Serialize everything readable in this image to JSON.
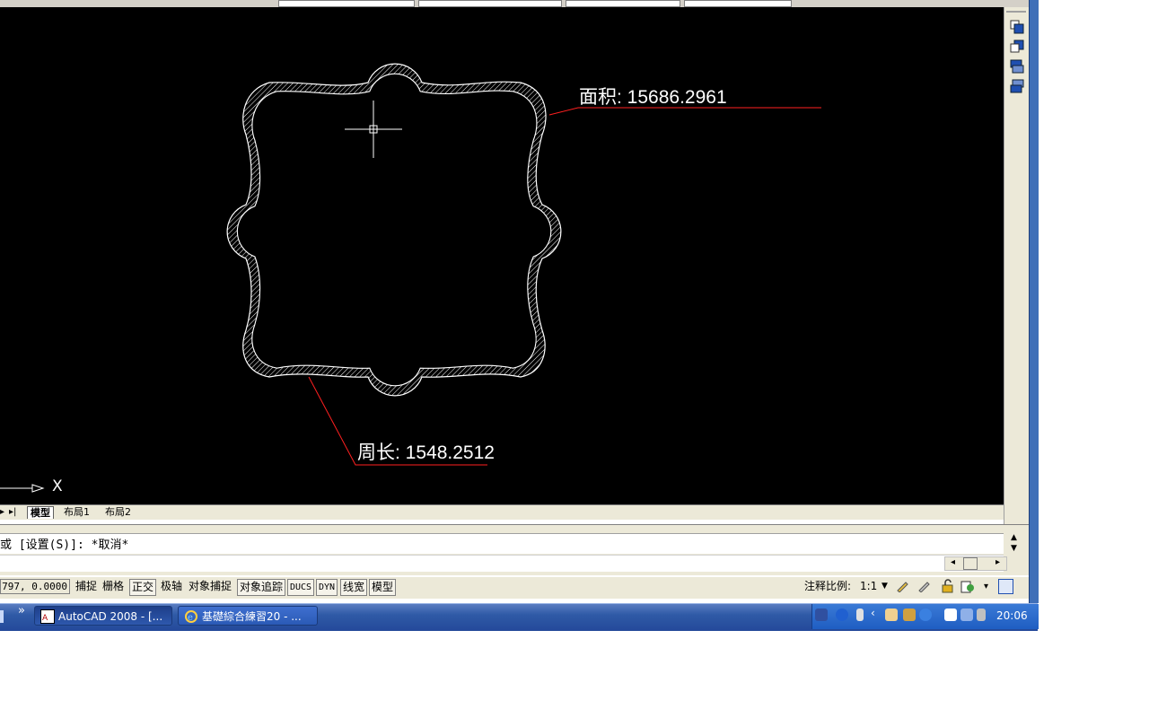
{
  "drawing": {
    "area_label": "面积",
    "area_value": "15686.2961",
    "perimeter_label": "周长",
    "perimeter_value": "1548.2512",
    "ucs_axis_x": "X"
  },
  "layout_tabs": {
    "model": "模型",
    "layout1": "布局1",
    "layout2": "布局2"
  },
  "command_line": {
    "history_text": "或 [设置(S)]: *取消*",
    "input_text": ""
  },
  "status_bar": {
    "coordinates": "797, 0.0000",
    "toggles": [
      "捕捉",
      "栅格",
      "正交",
      "极轴",
      "对象捕捉",
      "对象追踪",
      "DUCS",
      "DYN",
      "线宽",
      "模型"
    ],
    "annotation_scale_label": "注释比例:",
    "annotation_scale_value": "1:1"
  },
  "taskbar": {
    "tasks": [
      "AutoCAD 2008 - [...",
      "基礎綜合練習20 - ..."
    ],
    "clock": "20:06",
    "chevron": "»"
  },
  "colors": {
    "canvas": "#000000",
    "leader": "#ff2020",
    "text": "#ffffff",
    "window_bg": "#ece9d8",
    "taskbar": "#2f5aa6"
  }
}
